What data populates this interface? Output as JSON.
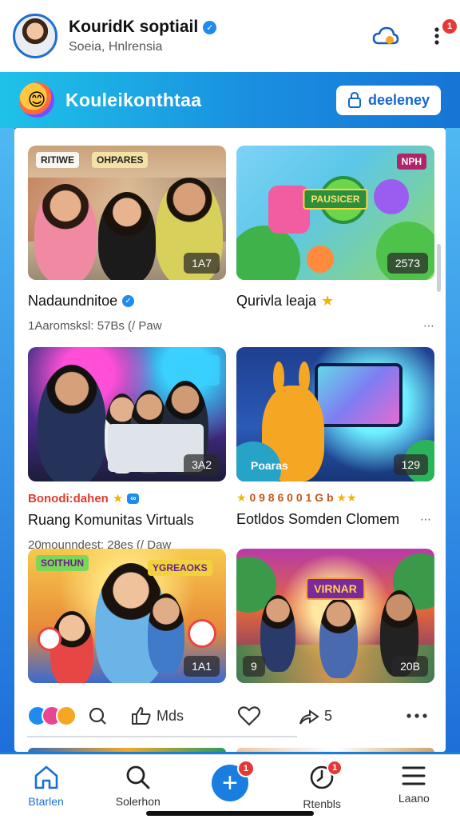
{
  "header": {
    "name": "KouridK soptiail",
    "subtitle": "Soeia, Hnlrensia",
    "notification_count": "1"
  },
  "banner": {
    "title": "Kouleikonthtaa",
    "join_label": "deeleney"
  },
  "posts": [
    {
      "title": "Nadaundnitoe",
      "meta": "1Aaromsksl: 57Bs (/ Paw",
      "image_count": "1A7",
      "image_tag": "RITIWE",
      "image_label": "OHPARES"
    },
    {
      "title": "Qurivla leaja",
      "meta": "",
      "image_count": "2573",
      "image_tag": "NPH",
      "image_label": "PAUSICER"
    },
    {
      "title": "Ruang Komunitas Virtuals",
      "highlight": "Bonodi:dahen",
      "meta": "20mounndest: 28es (/ Daw",
      "image_count": "3A2"
    },
    {
      "title": "Eotldos Somden Clomem",
      "stars_text": "0 9 8 6 0 0 1 G b",
      "image_count": "129",
      "image_caption": "Poaras"
    },
    {
      "title": "",
      "image_count": "1A1",
      "image_label": "SOITHUN",
      "image_label_2": "YGREAOKS"
    },
    {
      "title": "",
      "image_count": "20B",
      "image_count_left": "9",
      "image_label": "VIRNAR"
    }
  ],
  "actions": {
    "comment_label": "",
    "like_label": "Mds",
    "share_count": "5"
  },
  "nav": {
    "home": "Btarlen",
    "search": "Solerhon",
    "create_badge": "1",
    "events": "Rtenbls",
    "events_badge": "1",
    "menu": "Laano"
  },
  "colors": {
    "brand_blue": "#1a7de0",
    "badge_red": "#e53935",
    "highlight_red": "#e23b2e"
  }
}
